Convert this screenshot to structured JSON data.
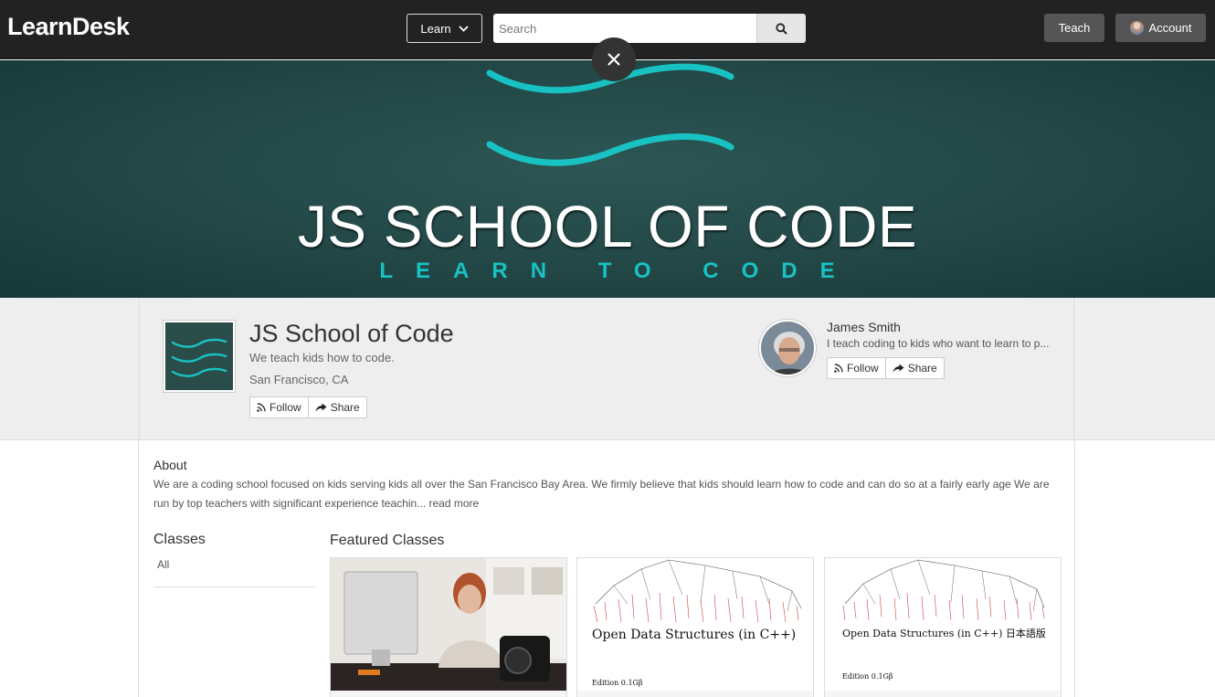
{
  "nav": {
    "logo": "LearnDesk",
    "learn_label": "Learn",
    "search_placeholder": "Search",
    "teach_label": "Teach",
    "account_label": "Account"
  },
  "banner": {
    "title": "JS SCHOOL OF CODE",
    "subtitle": "LEARN TO CODE",
    "accent_color": "#19c2c2"
  },
  "school": {
    "name": "JS School of Code",
    "tagline": "We teach kids how to code.",
    "location": "San Francisco, CA",
    "follow_label": "Follow",
    "share_label": "Share"
  },
  "teacher": {
    "name": "James Smith",
    "bio": "I teach coding to kids who want to learn to p...",
    "follow_label": "Follow",
    "share_label": "Share"
  },
  "about": {
    "heading": "About",
    "text": "We are a coding school focused on kids serving kids all over the San Francisco Bay Area. We firmly believe that kids should learn how to code and can do so at a fairly early age We are run by top teachers with significant experience teachin...",
    "read_more": "read more"
  },
  "classes": {
    "heading": "Classes",
    "items": [
      "All"
    ]
  },
  "featured": {
    "heading": "Featured Classes",
    "cards": [
      {
        "type": "photo"
      },
      {
        "type": "book",
        "title": "Open Data Structures (in C++)",
        "edition": "Edition 0.1Gβ"
      },
      {
        "type": "book",
        "title": "Open Data Structures (in C++) 日本語版",
        "edition": "Edition 0.1Gβ"
      }
    ]
  }
}
